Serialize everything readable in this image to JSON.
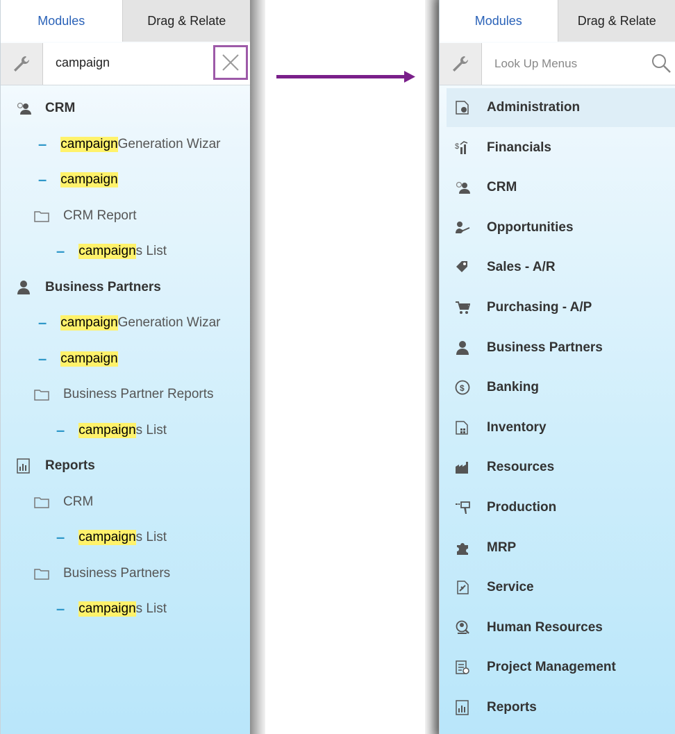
{
  "left_panel": {
    "tabs": {
      "modules": "Modules",
      "drag_relate": "Drag & Relate"
    },
    "search": {
      "value": "campaign"
    },
    "rows": [
      {
        "type": "module",
        "icon": "crm-people-icon",
        "label": "CRM"
      },
      {
        "type": "leaf",
        "indent": 1,
        "highlight": "campaign",
        "rest": " Generation Wizar"
      },
      {
        "type": "leaf",
        "indent": 1,
        "highlight": "campaign",
        "rest": ""
      },
      {
        "type": "folder",
        "indent": 1,
        "label": "CRM Report"
      },
      {
        "type": "leaf",
        "indent": 2,
        "highlight": "campaign",
        "rest": "s List"
      },
      {
        "type": "module",
        "icon": "business-partner-icon",
        "label": "Business Partners"
      },
      {
        "type": "leaf",
        "indent": 1,
        "highlight": "campaign",
        "rest": " Generation Wizar"
      },
      {
        "type": "leaf",
        "indent": 1,
        "highlight": "campaign",
        "rest": ""
      },
      {
        "type": "folder",
        "indent": 1,
        "label": "Business Partner Reports"
      },
      {
        "type": "leaf",
        "indent": 2,
        "highlight": "campaign",
        "rest": "s List"
      },
      {
        "type": "module",
        "icon": "reports-icon",
        "label": "Reports"
      },
      {
        "type": "folder",
        "indent": 1,
        "label": "CRM"
      },
      {
        "type": "leaf",
        "indent": 2,
        "highlight": "campaign",
        "rest": "s List"
      },
      {
        "type": "folder",
        "indent": 1,
        "label": "Business Partners"
      },
      {
        "type": "leaf",
        "indent": 2,
        "highlight": "campaign",
        "rest": "s List"
      }
    ]
  },
  "right_panel": {
    "tabs": {
      "modules": "Modules",
      "drag_relate": "Drag & Relate"
    },
    "search": {
      "placeholder": "Look Up Menus"
    },
    "modules": [
      {
        "label": "Administration",
        "icon": "administration-icon"
      },
      {
        "label": "Financials",
        "icon": "financials-icon"
      },
      {
        "label": "CRM",
        "icon": "crm-people-icon"
      },
      {
        "label": "Opportunities",
        "icon": "opportunities-icon"
      },
      {
        "label": "Sales - A/R",
        "icon": "sales-tag-icon"
      },
      {
        "label": "Purchasing - A/P",
        "icon": "cart-icon"
      },
      {
        "label": "Business Partners",
        "icon": "business-partner-icon"
      },
      {
        "label": "Banking",
        "icon": "banking-icon"
      },
      {
        "label": "Inventory",
        "icon": "inventory-icon"
      },
      {
        "label": "Resources",
        "icon": "resources-icon"
      },
      {
        "label": "Production",
        "icon": "production-icon"
      },
      {
        "label": "MRP",
        "icon": "mrp-puzzle-icon"
      },
      {
        "label": "Service",
        "icon": "service-icon"
      },
      {
        "label": "Human Resources",
        "icon": "human-resources-icon"
      },
      {
        "label": "Project Management",
        "icon": "project-management-icon"
      },
      {
        "label": "Reports",
        "icon": "reports-icon"
      }
    ]
  },
  "colors": {
    "accent_blue": "#2a62b8",
    "highlight": "#fff26b",
    "arrow": "#7a1f8a",
    "dash": "#2f98c9"
  }
}
